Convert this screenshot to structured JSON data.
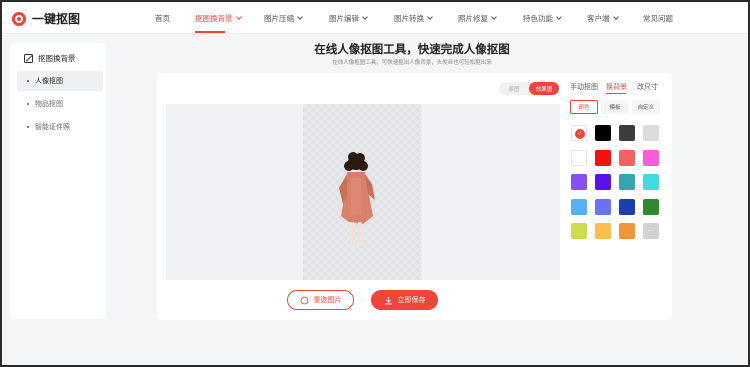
{
  "app": {
    "logo_text": "一键抠图"
  },
  "nav": {
    "items": [
      {
        "label": "首页"
      },
      {
        "label": "抠图换背景"
      },
      {
        "label": "图片压缩"
      },
      {
        "label": "图片编辑"
      },
      {
        "label": "图片转换"
      },
      {
        "label": "照片修复"
      },
      {
        "label": "特色功能"
      },
      {
        "label": "客户端"
      },
      {
        "label": "常见问题"
      }
    ]
  },
  "sidebar": {
    "title": "抠图换背景",
    "items": [
      {
        "label": "人像抠图"
      },
      {
        "label": "物品抠图"
      },
      {
        "label": "智能证件照"
      }
    ]
  },
  "main": {
    "title": "在线人像抠图工具，快速完成人像抠图",
    "subtitle": "在线人像抠图工具，可快速抠出人像背景，头发丝也可轻松抠出来"
  },
  "preview_toggle": {
    "original": "原图",
    "result": "效果图"
  },
  "actions": {
    "reselect": "重选图片",
    "save": "立即保存"
  },
  "panel": {
    "tabs": [
      "手动抠图",
      "换背景",
      "改尺寸"
    ],
    "subtabs": [
      "颜色",
      "模板",
      "自定义"
    ],
    "more_label": "···",
    "swatches": [
      "#ffffff",
      "#000000",
      "#3c3c3c",
      "#dcdcdc",
      "#ffffff",
      "#f50f0f",
      "#f26464",
      "#f75ed6",
      "#8a4ff2",
      "#5a12f0",
      "#35a5ae",
      "#40dbe0",
      "#57aff5",
      "#6a72f5",
      "#1d3eb0",
      "#2e8a2c",
      "#cddc4c",
      "#f9c04f",
      "#f09636",
      "#d2d2d2"
    ]
  },
  "colors": {
    "accent": "#f0453a"
  }
}
